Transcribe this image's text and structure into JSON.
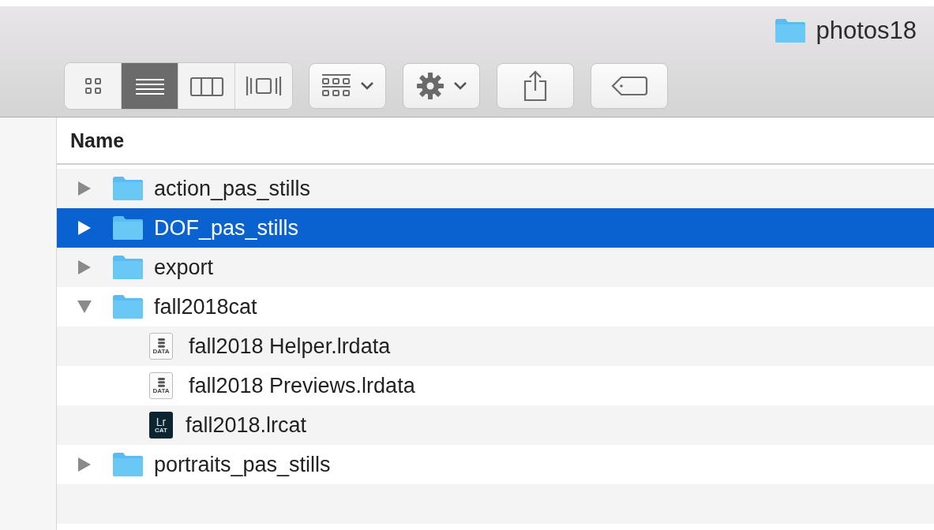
{
  "window": {
    "title": "photos18"
  },
  "toolbar": {
    "view_modes": [
      {
        "kind": "icons",
        "selected": false
      },
      {
        "kind": "list",
        "selected": true
      },
      {
        "kind": "columns",
        "selected": false
      },
      {
        "kind": "gallery",
        "selected": false
      }
    ]
  },
  "column_header": "Name",
  "items": [
    {
      "name": "action_pas_stills",
      "kind": "folder",
      "expanded": false,
      "selected": false
    },
    {
      "name": "DOF_pas_stills",
      "kind": "folder",
      "expanded": false,
      "selected": true
    },
    {
      "name": "export",
      "kind": "folder",
      "expanded": false,
      "selected": false
    },
    {
      "name": "fall2018cat",
      "kind": "folder",
      "expanded": true,
      "selected": false,
      "children": [
        {
          "name": "fall2018 Helper.lrdata",
          "kind": "data",
          "icon_text": [
            "DATA"
          ],
          "selected": false
        },
        {
          "name": "fall2018 Previews.lrdata",
          "kind": "data",
          "icon_text": [
            "DATA"
          ],
          "selected": false
        },
        {
          "name": "fall2018.lrcat",
          "kind": "lrcat",
          "icon_text": [
            "Lr",
            "CAT"
          ],
          "selected": false
        }
      ]
    },
    {
      "name": "portraits_pas_stills",
      "kind": "folder",
      "expanded": false,
      "selected": false
    }
  ]
}
